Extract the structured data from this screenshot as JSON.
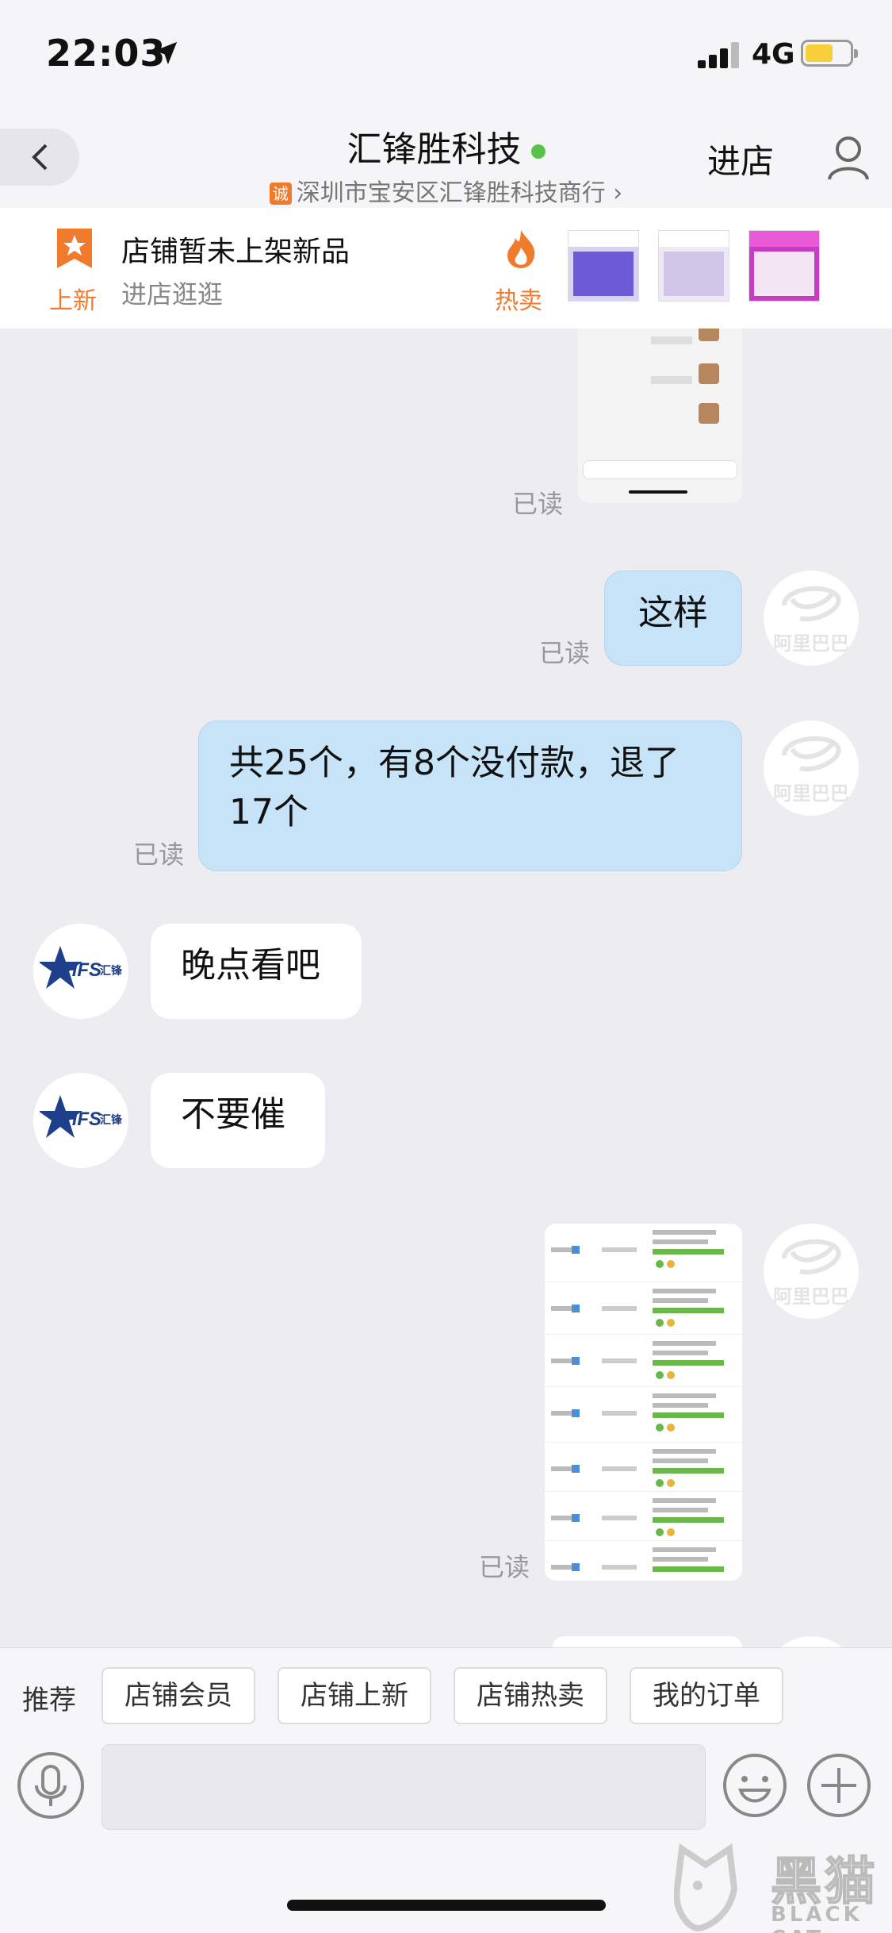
{
  "status_bar": {
    "time": "22:03",
    "network": "4G",
    "icons": [
      "location-arrow-icon",
      "signal-icon",
      "battery-icon"
    ]
  },
  "header": {
    "shop_name": "汇锋胜科技",
    "online": true,
    "shop_badge": "诚",
    "shop_subtitle": "深圳市宝安区汇锋胜科技商行 ›",
    "enter_store": "进店"
  },
  "promo": {
    "new_label": "上新",
    "title": "店铺暂未上架新品",
    "subtitle": "进店逛逛",
    "hot_label": "热卖"
  },
  "messages": [
    {
      "from": "me",
      "type": "image",
      "read_status": "已读"
    },
    {
      "from": "me",
      "type": "text",
      "text": "这样",
      "read_status": "已读"
    },
    {
      "from": "me",
      "type": "text",
      "text_line1": "共25个，有8个没付款，退了",
      "text_line2": "17个",
      "read_status": "已读"
    },
    {
      "from": "shop",
      "type": "text",
      "text": "晚点看吧"
    },
    {
      "from": "shop",
      "type": "text",
      "text": "不要催"
    },
    {
      "from": "me",
      "type": "image",
      "read_status": "已读"
    }
  ],
  "avatar_text": "阿里巴巴",
  "quick_replies": {
    "label": "推荐",
    "items": [
      "店铺会员",
      "店铺上新",
      "店铺热卖",
      "我的订单"
    ]
  },
  "watermark": {
    "cn": "黑猫",
    "en": "BLACK CAT"
  },
  "colors": {
    "my_bubble": "#c7e3f7",
    "accent": "#f07b2c",
    "online": "#58c24a",
    "background": "#ececf1"
  }
}
